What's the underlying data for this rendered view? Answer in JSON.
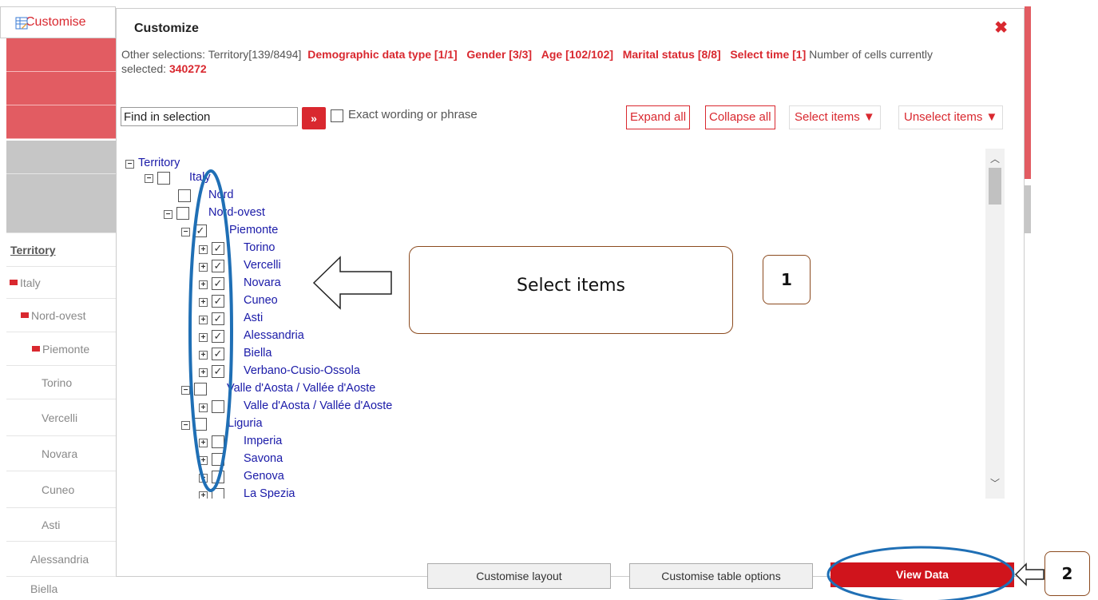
{
  "background": {
    "header_label": "Customise",
    "territory_header": "Territory",
    "rows": [
      "Italy",
      "Nord-ovest",
      "Piemonte",
      "Torino",
      "Vercelli",
      "Novara",
      "Cuneo",
      "Asti",
      "Alessandria",
      "Biella"
    ]
  },
  "modal": {
    "title": "Customize",
    "close": "✖",
    "selections_prefix": "Other selections:",
    "territory_sel": "Territory[139/8494]",
    "demographic": "Demographic data type [1/1]",
    "gender": "Gender [3/3]",
    "age": "Age [102/102]",
    "marital": "Marital status [8/8]",
    "select_time": "Select time [1]",
    "cells_label": "Number of cells currently selected:",
    "cells_value": "340272",
    "find_value": "Find in selection",
    "go": "»",
    "exact_label": "Exact wording or phrase",
    "expand_all": "Expand all",
    "collapse_all": "Collapse all",
    "select_items": "Select items",
    "unselect_items": "Unselect items",
    "tree": {
      "root": "Territory",
      "italy": "Italy",
      "nord": "Nord",
      "nord_ovest": "Nord-ovest",
      "piemonte": "Piemonte",
      "torino": "Torino",
      "vercelli": "Vercelli",
      "novara": "Novara",
      "cuneo": "Cuneo",
      "asti": "Asti",
      "alessandria": "Alessandria",
      "biella": "Biella",
      "verbano": "Verbano-Cusio-Ossola",
      "valle_region": "Valle d'Aosta / Vallée d'Aoste",
      "valle_prov": "Valle d'Aosta / Vallée d'Aoste",
      "liguria": "Liguria",
      "imperia": "Imperia",
      "savona": "Savona",
      "genova": "Genova",
      "la_spezia": "La Spezia"
    },
    "customise_layout": "Customise layout",
    "customise_table_options": "Customise table options",
    "view_data": "View Data"
  },
  "annotations": {
    "callout_text": "Select items",
    "num1": "1",
    "num2": "2"
  },
  "colors": {
    "accent": "#d9282f",
    "link": "#1a1aa8",
    "annotation_blue": "#1f6fb5"
  }
}
